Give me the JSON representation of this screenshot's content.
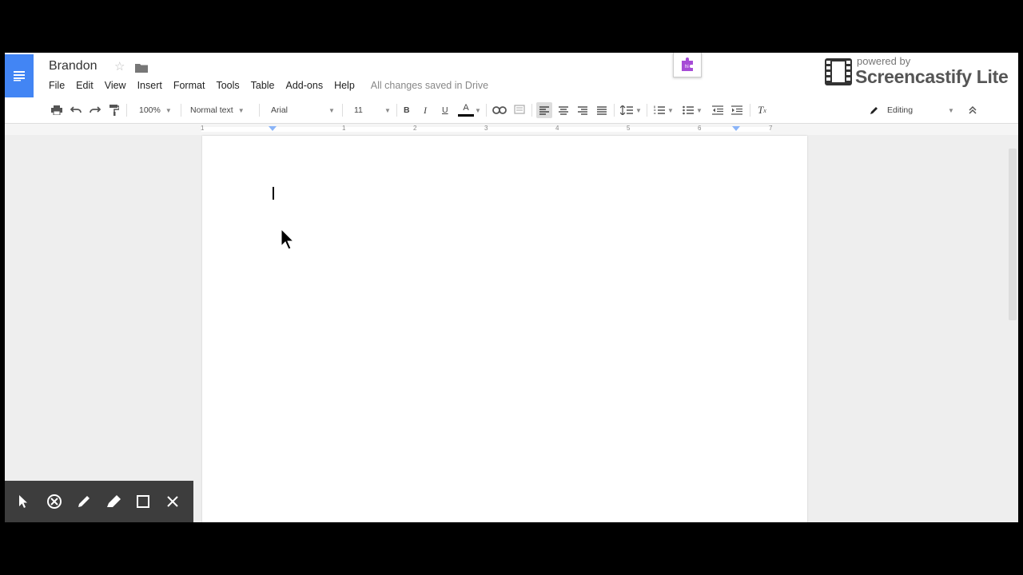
{
  "header": {
    "title": "Brandon",
    "menu": [
      "File",
      "Edit",
      "View",
      "Insert",
      "Format",
      "Tools",
      "Table",
      "Add-ons",
      "Help"
    ],
    "save_status": "All changes saved in Drive"
  },
  "watermark": {
    "powered_by": "powered by",
    "brand": "Screencastify Lite"
  },
  "toolbar": {
    "zoom": "100%",
    "style": "Normal text",
    "font": "Arial",
    "font_size": "11",
    "bold": "B",
    "italic": "I",
    "underline": "U",
    "text_color": "A",
    "mode": "Editing"
  },
  "ruler": {
    "labels": [
      "1",
      "1",
      "2",
      "3",
      "4",
      "5",
      "6",
      "7"
    ]
  },
  "colors": {
    "docs_blue": "#4285f4",
    "extension_purple": "#a64bd6"
  },
  "icons": [
    "docs-menu-icon",
    "star-icon",
    "folder-icon",
    "print-icon",
    "undo-icon",
    "redo-icon",
    "paint-format-icon",
    "link-icon",
    "comment-icon",
    "align-left-icon",
    "align-center-icon",
    "align-right-icon",
    "align-justify-icon",
    "line-spacing-icon",
    "numbered-list-icon",
    "bulleted-list-icon",
    "decrease-indent-icon",
    "increase-indent-icon",
    "clear-formatting-icon",
    "pencil-icon",
    "collapse-icon",
    "pointer-icon",
    "eraser-icon",
    "pen-icon",
    "highlighter-icon",
    "rectangle-icon",
    "close-icon"
  ]
}
